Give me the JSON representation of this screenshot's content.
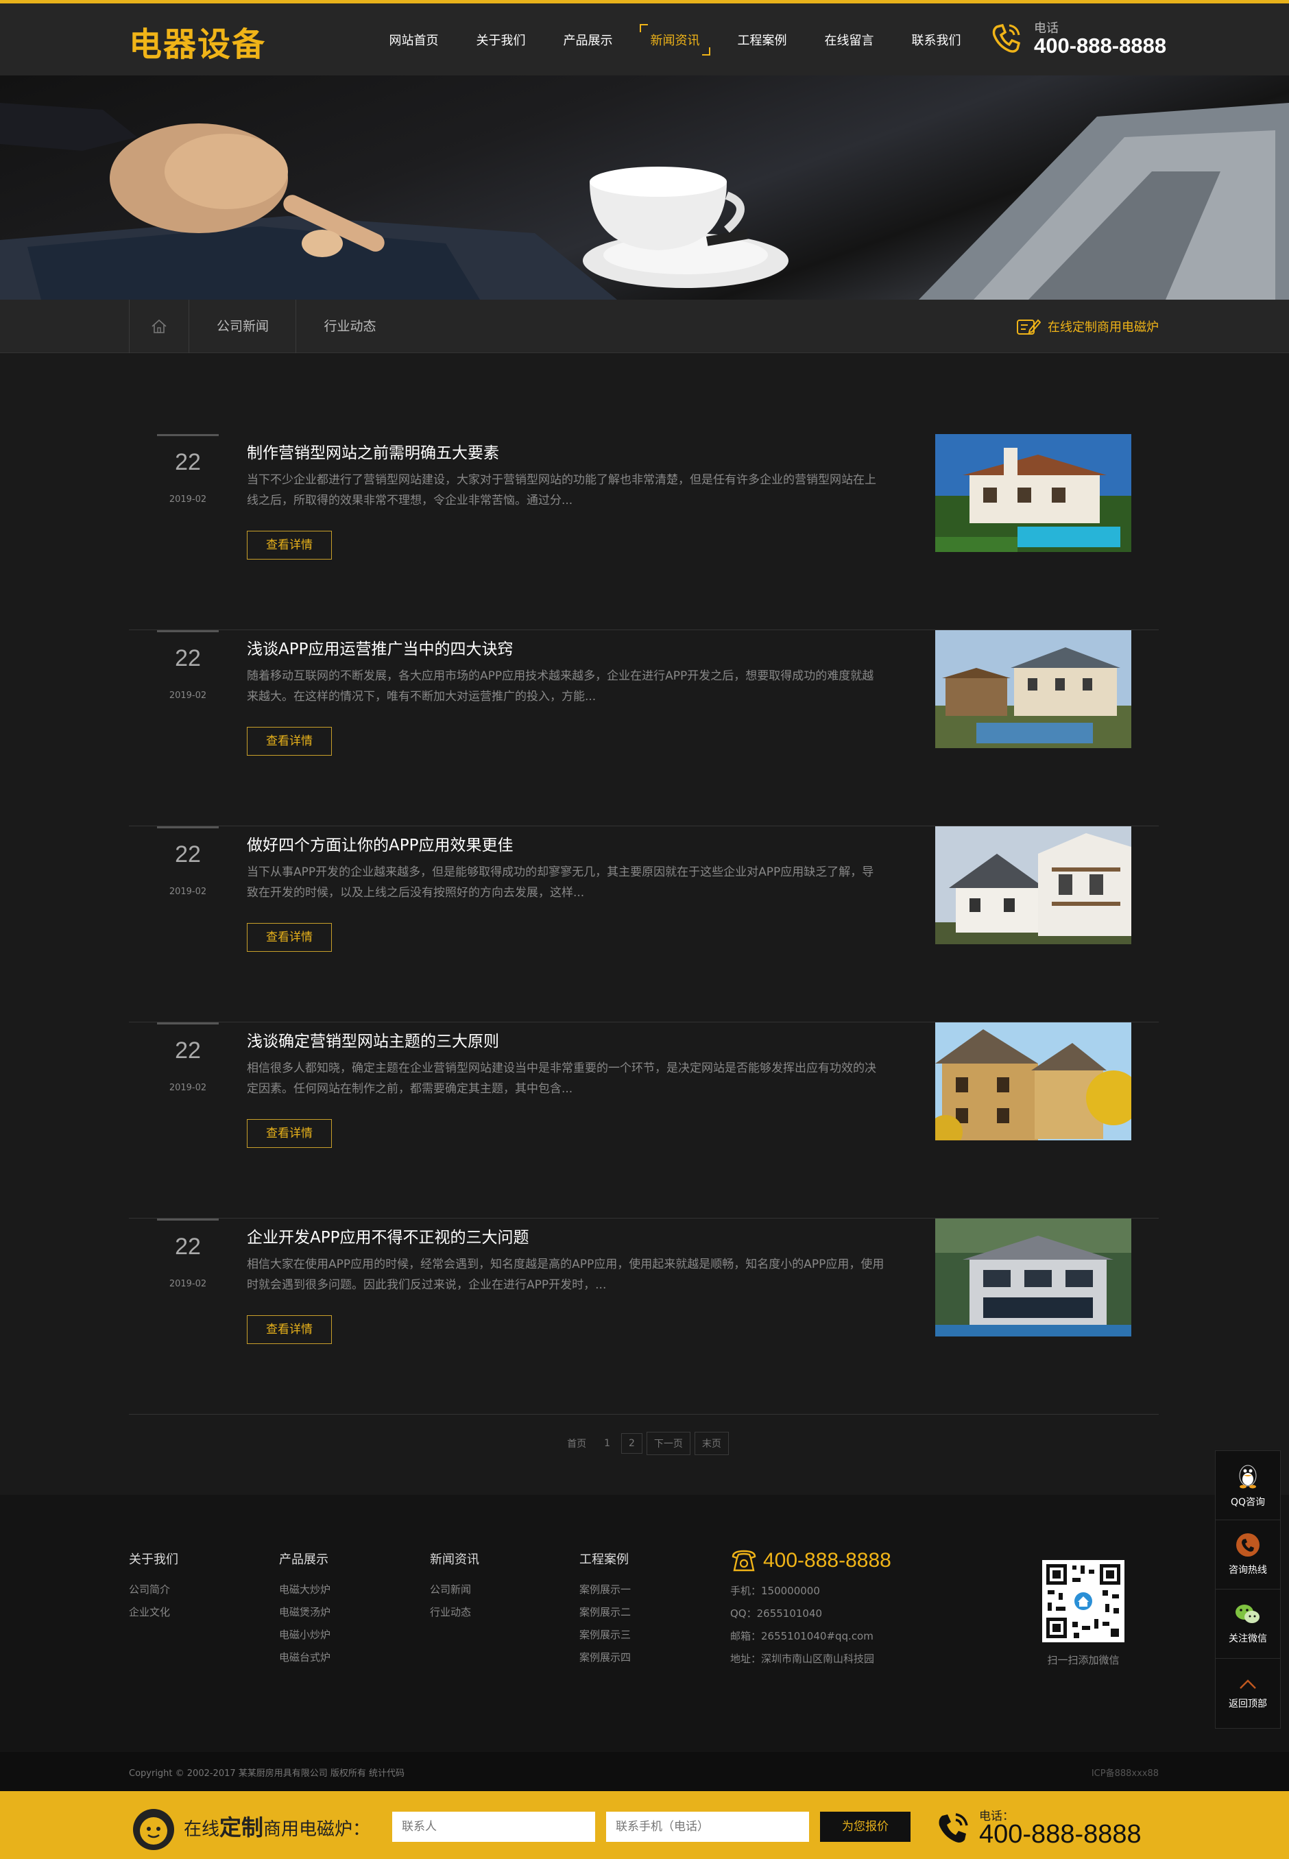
{
  "header": {
    "logo": "电器设备",
    "nav": [
      "网站首页",
      "关于我们",
      "产品展示",
      "新闻资讯",
      "工程案例",
      "在线留言",
      "联系我们"
    ],
    "active_nav": "新闻资讯",
    "phone_label": "电话",
    "phone": "400-888-8888"
  },
  "subnav": {
    "links": [
      "公司新闻",
      "行业动态"
    ],
    "right_link": "在线定制商用电磁炉"
  },
  "news": [
    {
      "day": "22",
      "ym": "2019-02",
      "title": "制作营销型网站之前需明确五大要素",
      "desc": "当下不少企业都进行了营销型网站建设，大家对于营销型网站的功能了解也非常清楚，但是任有许多企业的营销型网站在上线之后，所取得的效果非常不理想，令企业非常苦恼。通过分...",
      "btn": "查看详情"
    },
    {
      "day": "22",
      "ym": "2019-02",
      "title": "浅谈APP应用运营推广当中的四大诀窍",
      "desc": "随着移动互联网的不断发展，各大应用市场的APP应用技术越来越多，企业在进行APP开发之后，想要取得成功的难度就越来越大。在这样的情况下，唯有不断加大对运营推广的投入，方能...",
      "btn": "查看详情"
    },
    {
      "day": "22",
      "ym": "2019-02",
      "title": "做好四个方面让你的APP应用效果更佳",
      "desc": "当下从事APP开发的企业越来越多，但是能够取得成功的却寥寥无几，其主要原因就在于这些企业对APP应用缺乏了解，导致在开发的时候，以及上线之后没有按照好的方向去发展，这样...",
      "btn": "查看详情"
    },
    {
      "day": "22",
      "ym": "2019-02",
      "title": "浅谈确定营销型网站主题的三大原则",
      "desc": "相信很多人都知晓，确定主题在企业营销型网站建设当中是非常重要的一个环节，是决定网站是否能够发挥出应有功效的决定因素。任何网站在制作之前，都需要确定其主题，其中包含...",
      "btn": "查看详情"
    },
    {
      "day": "22",
      "ym": "2019-02",
      "title": "企业开发APP应用不得不正视的三大问题",
      "desc": "相信大家在使用APP应用的时候，经常会遇到，知名度越是高的APP应用，使用起来就越是顺畅，知名度小的APP应用，使用时就会遇到很多问题。因此我们反过来说，企业在进行APP开发时，...",
      "btn": "查看详情"
    }
  ],
  "pagination": {
    "first": "首页",
    "p1": "1",
    "p2": "2",
    "next": "下一页",
    "last": "末页"
  },
  "footer": {
    "columns": [
      {
        "title": "关于我们",
        "items": [
          "公司简介",
          "企业文化"
        ]
      },
      {
        "title": "产品展示",
        "items": [
          "电磁大炒炉",
          "电磁煲汤炉",
          "电磁小炒炉",
          "电磁台式炉"
        ]
      },
      {
        "title": "新闻资讯",
        "items": [
          "公司新闻",
          "行业动态"
        ]
      },
      {
        "title": "工程案例",
        "items": [
          "案例展示一",
          "案例展示二",
          "案例展示三",
          "案例展示四"
        ]
      }
    ],
    "phone": "400-888-8888",
    "mobile": "手机：150000000",
    "qq": "QQ：2655101040",
    "email": "邮箱：2655101040#qq.com",
    "address": "地址：深圳市南山区南山科技园",
    "qr_label": "扫一扫添加微信",
    "copyright": "Copyright © 2002-2017 某某厨房用具有限公司 版权所有 统计代码",
    "icp": "ICP备888xxx88"
  },
  "bottombar": {
    "text_pre": "在线",
    "text_bold": "定制",
    "text_post": "商用电磁炉：",
    "contact_placeholder": "联系人",
    "phone_placeholder": "联系手机（电话）",
    "submit": "为您报价",
    "phone_label": "电话：",
    "phone": "400-888-8888"
  },
  "float": [
    "QQ咨询",
    "咨询热线",
    "关注微信",
    "返回顶部"
  ],
  "colors": {
    "accent": "#e8b21b",
    "bg": "#1a1a1a",
    "header": "#262626"
  }
}
